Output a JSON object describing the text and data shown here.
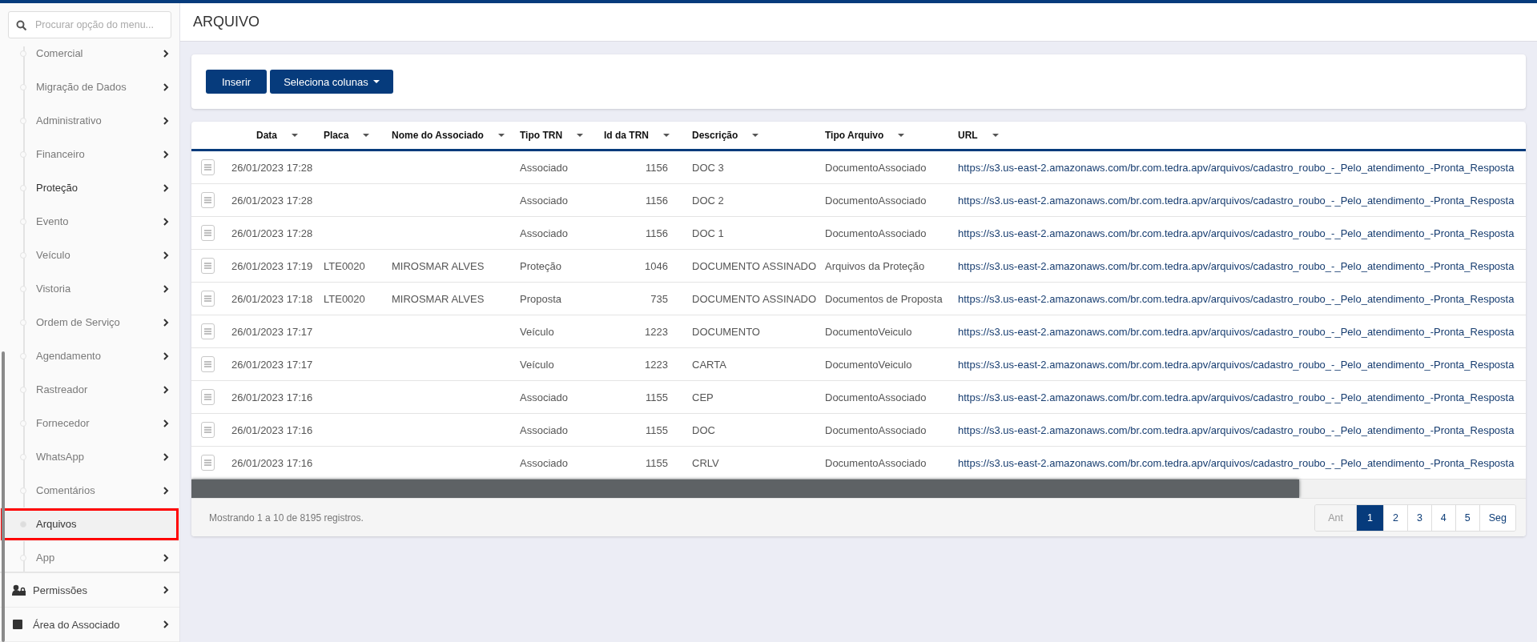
{
  "search": {
    "placeholder": "Procurar opção do menu..."
  },
  "sidebar": {
    "items": [
      {
        "label": "Comercial",
        "has_submenu": true,
        "highlighted": false,
        "selected": false
      },
      {
        "label": "Migração de Dados",
        "has_submenu": true,
        "highlighted": false,
        "selected": false
      },
      {
        "label": "Administrativo",
        "has_submenu": true,
        "highlighted": false,
        "selected": false
      },
      {
        "label": "Financeiro",
        "has_submenu": true,
        "highlighted": false,
        "selected": false
      },
      {
        "label": "Proteção",
        "has_submenu": true,
        "highlighted": true,
        "selected": false
      },
      {
        "label": "Evento",
        "has_submenu": true,
        "highlighted": false,
        "selected": false
      },
      {
        "label": "Veículo",
        "has_submenu": true,
        "highlighted": false,
        "selected": false
      },
      {
        "label": "Vistoria",
        "has_submenu": true,
        "highlighted": false,
        "selected": false
      },
      {
        "label": "Ordem de Serviço",
        "has_submenu": true,
        "highlighted": false,
        "selected": false
      },
      {
        "label": "Agendamento",
        "has_submenu": true,
        "highlighted": false,
        "selected": false
      },
      {
        "label": "Rastreador",
        "has_submenu": true,
        "highlighted": false,
        "selected": false
      },
      {
        "label": "Fornecedor",
        "has_submenu": true,
        "highlighted": false,
        "selected": false
      },
      {
        "label": "WhatsApp",
        "has_submenu": true,
        "highlighted": false,
        "selected": false
      },
      {
        "label": "Comentários",
        "has_submenu": true,
        "highlighted": false,
        "selected": false
      },
      {
        "label": "Arquivos",
        "has_submenu": false,
        "highlighted": false,
        "selected": true
      },
      {
        "label": "App",
        "has_submenu": true,
        "highlighted": false,
        "selected": false
      }
    ],
    "sections": [
      {
        "label": "Permissões",
        "kind": "permissions"
      },
      {
        "label": "Área do Associado",
        "kind": "area"
      }
    ]
  },
  "page": {
    "title": "ARQUIVO"
  },
  "toolbar": {
    "buttons": [
      {
        "label": "Inserir",
        "kind": "button"
      },
      {
        "label": "Seleciona colunas",
        "kind": "dropdown"
      }
    ]
  },
  "table": {
    "columns": [
      {
        "label": "Data",
        "kind": "text"
      },
      {
        "label": "Placa",
        "kind": "text"
      },
      {
        "label": "Nome do Associado",
        "kind": "text"
      },
      {
        "label": "Tipo TRN",
        "kind": "text"
      },
      {
        "label": "Id da TRN",
        "kind": "number"
      },
      {
        "label": "Descrição",
        "kind": "text"
      },
      {
        "label": "Tipo Arquivo",
        "kind": "text"
      },
      {
        "label": "URL",
        "kind": "link"
      }
    ],
    "rows": [
      [
        "26/01/2023 17:28",
        null,
        null,
        "Associado",
        "1156",
        "DOC 3",
        "DocumentoAssociado",
        "https://s3.us-east-2.amazonaws.com/br.com.tedra.apv/arquivos/cadastro_roubo_-_Pelo_atendimento_-Pronta_Resposta"
      ],
      [
        "26/01/2023 17:28",
        null,
        null,
        "Associado",
        "1156",
        "DOC 2",
        "DocumentoAssociado",
        "https://s3.us-east-2.amazonaws.com/br.com.tedra.apv/arquivos/cadastro_roubo_-_Pelo_atendimento_-Pronta_Resposta"
      ],
      [
        "26/01/2023 17:28",
        null,
        null,
        "Associado",
        "1156",
        "DOC 1",
        "DocumentoAssociado",
        "https://s3.us-east-2.amazonaws.com/br.com.tedra.apv/arquivos/cadastro_roubo_-_Pelo_atendimento_-Pronta_Resposta"
      ],
      [
        "26/01/2023 17:19",
        "LTE0020",
        "MIROSMAR ALVES",
        "Proteção",
        "1046",
        "DOCUMENTO ASSINADO",
        "Arquivos da Proteção",
        "https://s3.us-east-2.amazonaws.com/br.com.tedra.apv/arquivos/cadastro_roubo_-_Pelo_atendimento_-Pronta_Resposta"
      ],
      [
        "26/01/2023 17:18",
        "LTE0020",
        "MIROSMAR ALVES",
        "Proposta",
        "735",
        "DOCUMENTO ASSINADO",
        "Documentos de Proposta",
        "https://s3.us-east-2.amazonaws.com/br.com.tedra.apv/arquivos/cadastro_roubo_-_Pelo_atendimento_-Pronta_Resposta"
      ],
      [
        "26/01/2023 17:17",
        null,
        null,
        "Veículo",
        "1223",
        "DOCUMENTO",
        "DocumentoVeiculo",
        "https://s3.us-east-2.amazonaws.com/br.com.tedra.apv/arquivos/cadastro_roubo_-_Pelo_atendimento_-Pronta_Resposta"
      ],
      [
        "26/01/2023 17:17",
        null,
        null,
        "Veículo",
        "1223",
        "CARTA",
        "DocumentoVeiculo",
        "https://s3.us-east-2.amazonaws.com/br.com.tedra.apv/arquivos/cadastro_roubo_-_Pelo_atendimento_-Pronta_Resposta"
      ],
      [
        "26/01/2023 17:16",
        null,
        null,
        "Associado",
        "1155",
        "CEP",
        "DocumentoAssociado",
        "https://s3.us-east-2.amazonaws.com/br.com.tedra.apv/arquivos/cadastro_roubo_-_Pelo_atendimento_-Pronta_Resposta"
      ],
      [
        "26/01/2023 17:16",
        null,
        null,
        "Associado",
        "1155",
        "DOC",
        "DocumentoAssociado",
        "https://s3.us-east-2.amazonaws.com/br.com.tedra.apv/arquivos/cadastro_roubo_-_Pelo_atendimento_-Pronta_Resposta"
      ],
      [
        "26/01/2023 17:16",
        null,
        null,
        "Associado",
        "1155",
        "CRLV",
        "DocumentoAssociado",
        "https://s3.us-east-2.amazonaws.com/br.com.tedra.apv/arquivos/cadastro_roubo_-_Pelo_atendimento_-Pronta_Resposta"
      ]
    ]
  },
  "footer": {
    "summary": "Mostrando 1 a 10 de 8195 registros.",
    "pagination": [
      {
        "label": "Ant",
        "selected": false,
        "disabled": true
      },
      {
        "label": "1",
        "selected": true,
        "disabled": false
      },
      {
        "label": "2",
        "selected": false,
        "disabled": false
      },
      {
        "label": "3",
        "selected": false,
        "disabled": false
      },
      {
        "label": "4",
        "selected": false,
        "disabled": false
      },
      {
        "label": "5",
        "selected": false,
        "disabled": false
      },
      {
        "label": "Seg",
        "selected": false,
        "disabled": false
      }
    ]
  }
}
